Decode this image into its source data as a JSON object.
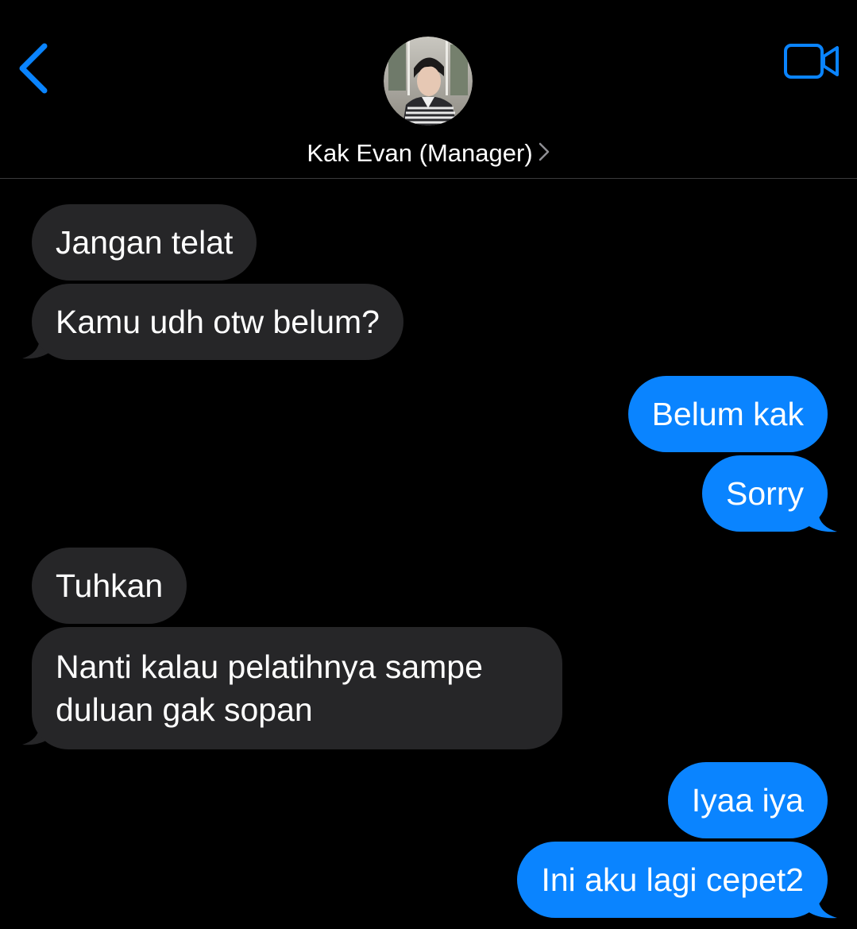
{
  "app": {
    "colors": {
      "background": "#000000",
      "accent": "#0a84ff",
      "incoming_bubble": "#262628",
      "outgoing_bubble": "#0a84ff",
      "text": "#ffffff",
      "divider": "#3a3a3c"
    }
  },
  "header": {
    "back_icon": "chevron-left-icon",
    "video_icon": "video-camera-icon",
    "contact_name": "Kak Evan (Manager)",
    "contact_chevron_icon": "chevron-right-icon"
  },
  "messages": [
    {
      "direction": "incoming",
      "text": "Jangan telat"
    },
    {
      "direction": "incoming",
      "text": "Kamu udh otw belum?"
    },
    {
      "direction": "outgoing",
      "text": "Belum kak"
    },
    {
      "direction": "outgoing",
      "text": "Sorry"
    },
    {
      "direction": "incoming",
      "text": "Tuhkan"
    },
    {
      "direction": "incoming",
      "lines": [
        "Nanti kalau pelatihnya sampe",
        "duluan gak sopan"
      ]
    },
    {
      "direction": "outgoing",
      "text": "Iyaa iya"
    },
    {
      "direction": "outgoing",
      "text": "Ini aku lagi cepet2"
    }
  ]
}
